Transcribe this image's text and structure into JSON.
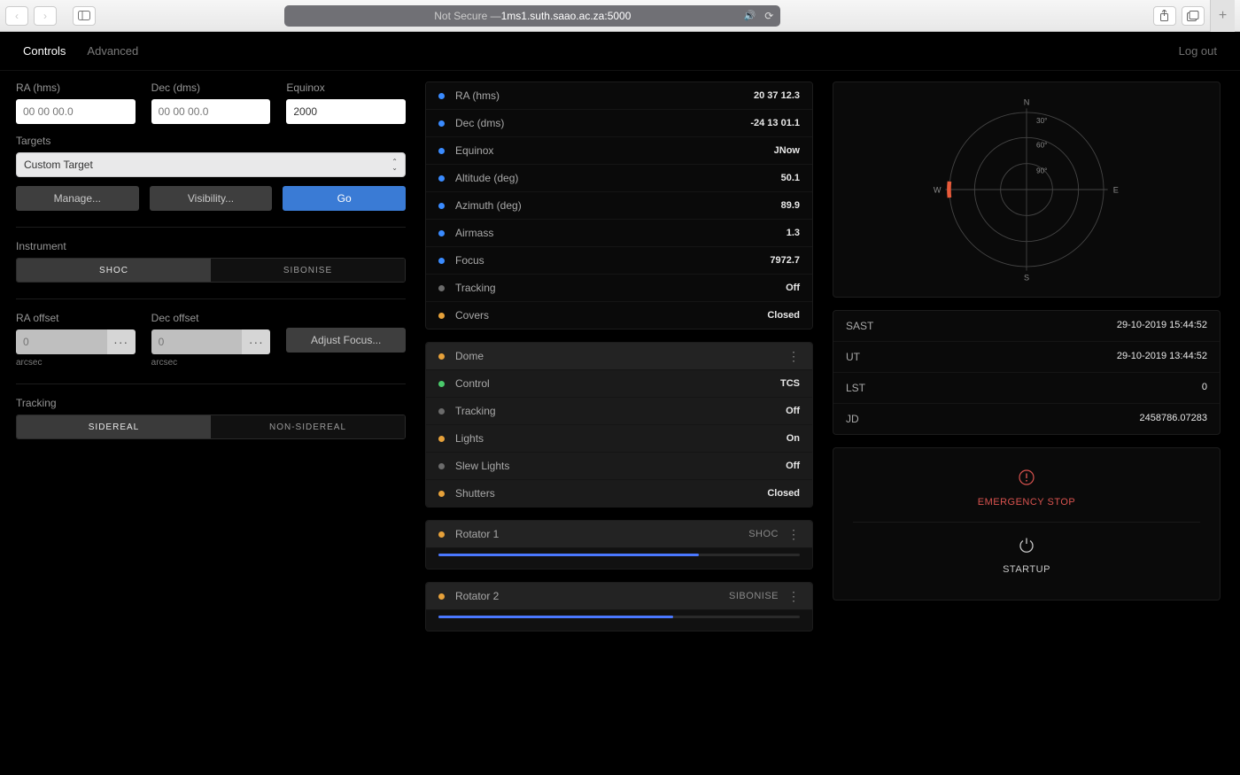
{
  "chrome": {
    "address_prefix": "Not Secure — ",
    "address_host": "1ms1.suth.saao.ac.za:5000"
  },
  "header": {
    "tab_controls": "Controls",
    "tab_advanced": "Advanced",
    "logout": "Log out"
  },
  "left": {
    "ra_label": "RA (hms)",
    "ra_placeholder": "00 00 00.0",
    "dec_label": "Dec (dms)",
    "dec_placeholder": "00 00 00.0",
    "equinox_label": "Equinox",
    "equinox_value": "2000",
    "targets_label": "Targets",
    "targets_selected": "Custom Target",
    "manage_btn": "Manage...",
    "visibility_btn": "Visibility...",
    "go_btn": "Go",
    "instrument_label": "Instrument",
    "instrument_a": "SHOC",
    "instrument_b": "SIBONISE",
    "ra_offset_label": "RA offset",
    "ra_offset_placeholder": "0",
    "dec_offset_label": "Dec offset",
    "dec_offset_placeholder": "0",
    "arcsec": "arcsec",
    "adjust_focus_btn": "Adjust Focus...",
    "tracking_label": "Tracking",
    "tracking_a": "SIDEREAL",
    "tracking_b": "NON-SIDEREAL"
  },
  "status": [
    {
      "dot": "blue",
      "label": "RA (hms)",
      "value": "20 37 12.3"
    },
    {
      "dot": "blue",
      "label": "Dec (dms)",
      "value": "-24 13 01.1"
    },
    {
      "dot": "blue",
      "label": "Equinox",
      "value": "JNow"
    },
    {
      "dot": "blue",
      "label": "Altitude (deg)",
      "value": "50.1"
    },
    {
      "dot": "blue",
      "label": "Azimuth (deg)",
      "value": "89.9"
    },
    {
      "dot": "blue",
      "label": "Airmass",
      "value": "1.3"
    },
    {
      "dot": "blue",
      "label": "Focus",
      "value": "7972.7"
    },
    {
      "dot": "grey",
      "label": "Tracking",
      "value": "Off"
    },
    {
      "dot": "orange",
      "label": "Covers",
      "value": "Closed"
    }
  ],
  "dome_header": "Dome",
  "dome_rows": [
    {
      "dot": "green",
      "label": "Control",
      "value": "TCS"
    },
    {
      "dot": "grey",
      "label": "Tracking",
      "value": "Off"
    },
    {
      "dot": "orange",
      "label": "Lights",
      "value": "On"
    },
    {
      "dot": "grey",
      "label": "Slew Lights",
      "value": "Off"
    },
    {
      "dot": "orange",
      "label": "Shutters",
      "value": "Closed"
    }
  ],
  "rotator1": {
    "label": "Rotator 1",
    "tag": "SHOC",
    "progress": 72
  },
  "rotator2": {
    "label": "Rotator 2",
    "tag": "SIBONISE",
    "progress": 65
  },
  "times": [
    {
      "label": "SAST",
      "value": "29-10-2019 15:44:52"
    },
    {
      "label": "UT",
      "value": "29-10-2019 13:44:52"
    },
    {
      "label": "LST",
      "value": "0"
    },
    {
      "label": "JD",
      "value": "2458786.07283"
    }
  ],
  "compass": {
    "n": "N",
    "s": "S",
    "e": "E",
    "w": "W",
    "r30": "30°",
    "r60": "60°",
    "r90": "90°"
  },
  "actions": {
    "emergency": "EMERGENCY STOP",
    "startup": "STARTUP"
  }
}
